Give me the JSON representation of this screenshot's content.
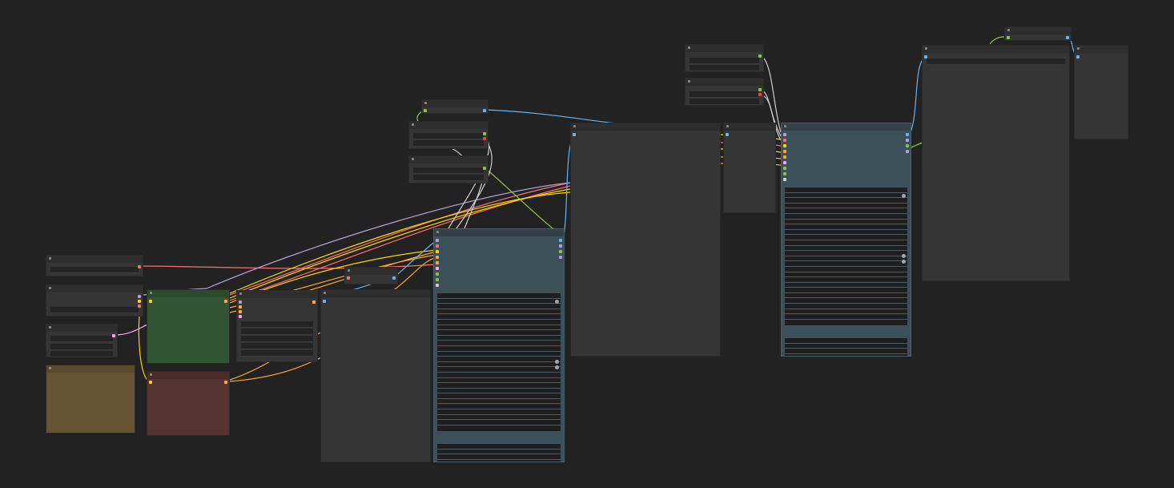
{
  "canvas": {
    "background": "#222222"
  },
  "colors": {
    "clip": "#ffd500",
    "model": "#b39ddb",
    "conditioning": "#ffa931",
    "latent": "#ff9cf9",
    "vae": "#ff6e6e",
    "image": "#64b5f6",
    "int": "#8bc34a",
    "float": "#aaaaaa",
    "node_body": "#353535",
    "sampler_body": "#3c5059",
    "positive_body": "#335533",
    "negative_body": "#553333",
    "note_body": "#665533"
  },
  "nodes": [
    {
      "id": "loader-1"
    },
    {
      "id": "loader-2"
    },
    {
      "id": "loader-3"
    },
    {
      "id": "note"
    },
    {
      "id": "positive-prompt"
    },
    {
      "id": "negative-prompt"
    },
    {
      "id": "lora"
    },
    {
      "id": "small-1"
    },
    {
      "id": "preview-left"
    },
    {
      "id": "sampler-1"
    },
    {
      "id": "mid-1"
    },
    {
      "id": "mid-2"
    },
    {
      "id": "mid-3"
    },
    {
      "id": "preview-mid"
    },
    {
      "id": "mid-narrow"
    },
    {
      "id": "top-1"
    },
    {
      "id": "top-2"
    },
    {
      "id": "sampler-2"
    },
    {
      "id": "save-image"
    },
    {
      "id": "top-right-small"
    },
    {
      "id": "right-panel"
    }
  ]
}
